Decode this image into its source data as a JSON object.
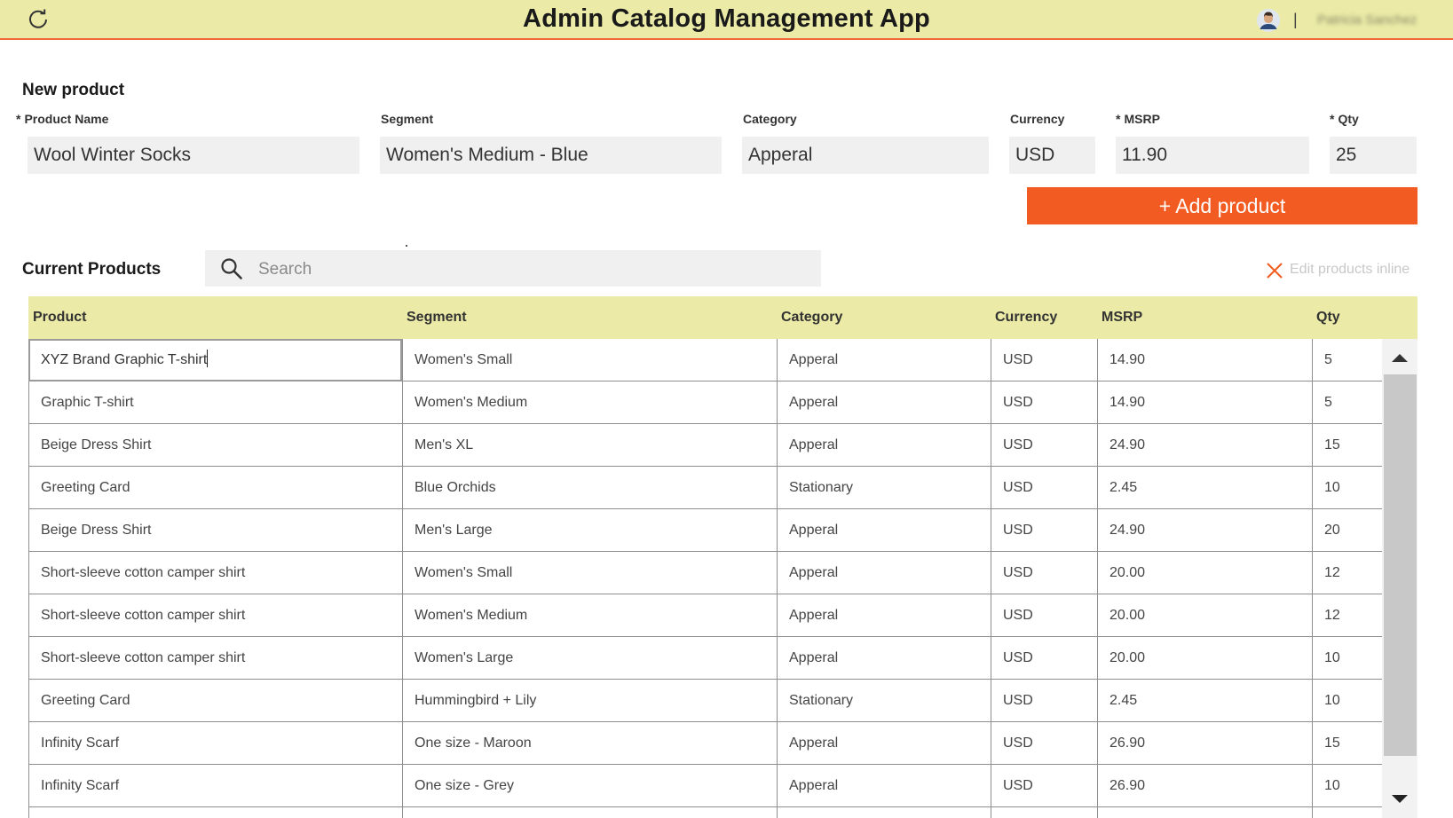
{
  "app": {
    "title": "Admin Catalog Management App",
    "user_name": "Patricia Sanchez"
  },
  "new_product": {
    "heading": "New product",
    "required_mark": "*",
    "fields": {
      "product_name": {
        "label": "Product Name",
        "value": "Wool Winter Socks"
      },
      "segment": {
        "label": "Segment",
        "value": "Women's Medium - Blue"
      },
      "category": {
        "label": "Category",
        "value": "Apperal"
      },
      "currency": {
        "label": "Currency",
        "value": "USD"
      },
      "msrp": {
        "label": "MSRP",
        "value": "11.90"
      },
      "qty": {
        "label": "Qty",
        "value": "25"
      }
    },
    "add_button": "+ Add product"
  },
  "current_products": {
    "heading": "Current Products",
    "search_placeholder": "Search",
    "edit_inline_label": "Edit products inline",
    "columns": [
      "Product",
      "Segment",
      "Category",
      "Currency",
      "MSRP",
      "Qty"
    ],
    "rows": [
      [
        "XYZ Brand Graphic T-shirt",
        "Women's Small",
        "Apperal",
        "USD",
        "14.90",
        "5"
      ],
      [
        "Graphic T-shirt",
        "Women's Medium",
        "Apperal",
        "USD",
        "14.90",
        "5"
      ],
      [
        "Beige Dress Shirt",
        "Men's XL",
        "Apperal",
        "USD",
        "24.90",
        "15"
      ],
      [
        "Greeting Card",
        "Blue Orchids",
        "Stationary",
        "USD",
        "2.45",
        "10"
      ],
      [
        "Beige Dress Shirt",
        "Men's Large",
        "Apperal",
        "USD",
        "24.90",
        "20"
      ],
      [
        "Short-sleeve cotton camper shirt",
        "Women's Small",
        "Apperal",
        "USD",
        "20.00",
        "12"
      ],
      [
        "Short-sleeve cotton camper shirt",
        "Women's Medium",
        "Apperal",
        "USD",
        "20.00",
        "12"
      ],
      [
        "Short-sleeve cotton camper shirt",
        "Women's Large",
        "Apperal",
        "USD",
        "20.00",
        "10"
      ],
      [
        "Greeting Card",
        "Hummingbird + Lily",
        "Stationary",
        "USD",
        "2.45",
        "10"
      ],
      [
        "Infinity Scarf",
        "One size - Maroon",
        "Apperal",
        "USD",
        "26.90",
        "15"
      ],
      [
        "Infinity Scarf",
        "One size - Grey",
        "Apperal",
        "USD",
        "26.90",
        "10"
      ]
    ]
  },
  "colors": {
    "header_bg": "#ebeba7",
    "accent": "#f25c22",
    "field_bg": "#f0f0f0"
  },
  "icons": [
    "refresh-icon",
    "avatar-icon",
    "search-icon",
    "close-icon",
    "scroll-up-arrow-icon",
    "scroll-down-arrow-icon"
  ]
}
